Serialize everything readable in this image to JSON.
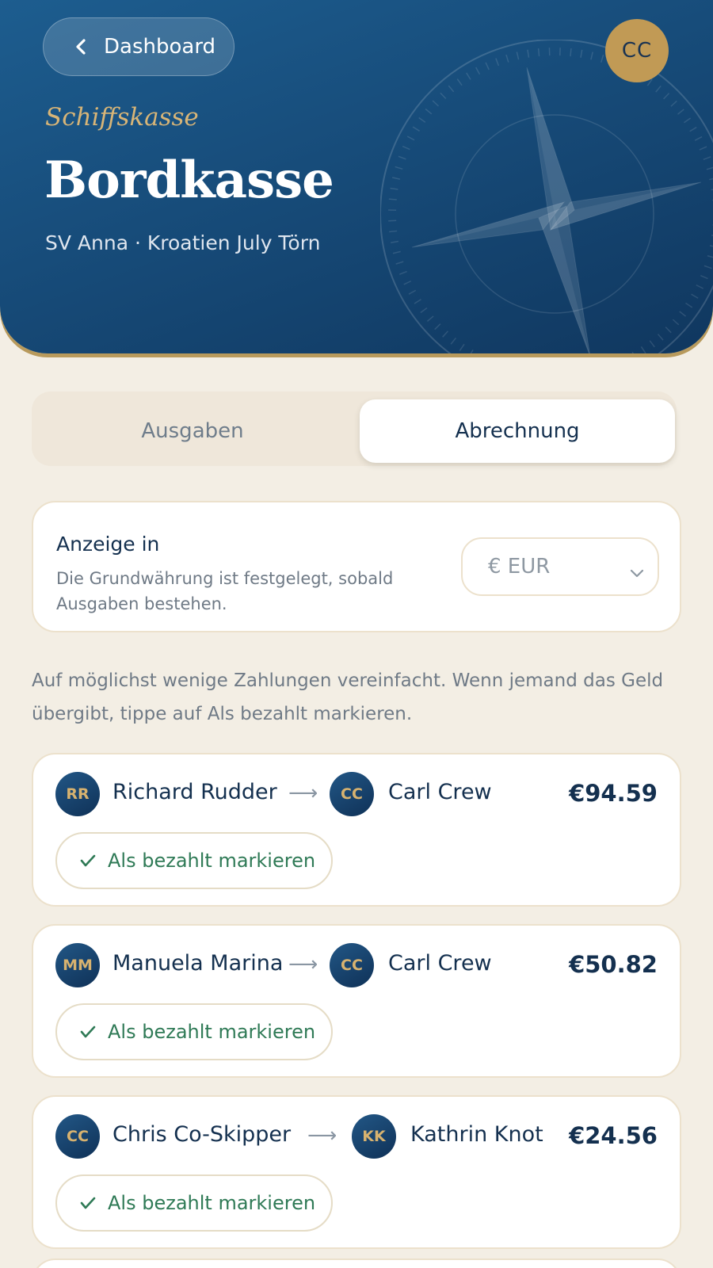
{
  "header": {
    "back_label": "Dashboard",
    "user_initials": "CC",
    "eyebrow": "Schiffskasse",
    "title": "Bordkasse",
    "subtitle": "SV Anna · Kroatien July Törn"
  },
  "tabs": [
    {
      "label": "Ausgaben",
      "active": false
    },
    {
      "label": "Abrechnung",
      "active": true
    }
  ],
  "display_currency": {
    "title": "Anzeige in",
    "description": "Die Grundwährung ist festgelegt, sobald Ausgaben bestehen.",
    "selected": "€ EUR"
  },
  "intro_text": "Auf möglichst wenige Zahlungen vereinfacht. Wenn jemand das Geld übergibt, tippe auf Als bezahlt markieren.",
  "settlements": [
    {
      "from_initials": "RR",
      "from_name": "Richard Rudder",
      "arrow": "⟶",
      "to_initials": "CC",
      "to_name": "Carl Crew",
      "amount": "€94.59",
      "action": "Als bezahlt markieren"
    },
    {
      "from_initials": "MM",
      "from_name": "Manuela Marina",
      "arrow": "⟶",
      "to_initials": "CC",
      "to_name": "Carl Crew",
      "amount": "€50.82",
      "action": "Als bezahlt markieren"
    },
    {
      "from_initials": "CC",
      "from_name": "Chris Co-Skipper",
      "arrow": "⟶",
      "to_initials": "KK",
      "to_name": "Kathrin Knot",
      "amount": "€24.56",
      "action": "Als bezahlt markieren"
    }
  ],
  "colors": {
    "header_navy": "#174c7a",
    "gold": "#c19a55",
    "background": "#f3eee4",
    "success_green": "#2f7a56"
  }
}
